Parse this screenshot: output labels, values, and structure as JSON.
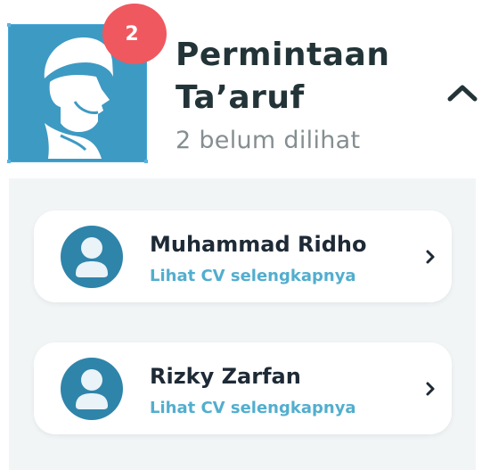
{
  "header": {
    "title_line1": "Permintaan",
    "title_line2": "Ta’aruf",
    "subtitle": "2 belum dilihat",
    "badge_count": "2",
    "logo_icon": "bearded-man-profile-icon",
    "collapse_icon": "chevron-up-icon"
  },
  "requests": [
    {
      "name": "Muhammad Ridho",
      "link": "Lihat CV selengkapnya",
      "avatar_icon": "user-avatar-icon"
    },
    {
      "name": "Rizky Zarfan",
      "link": "Lihat CV selengkapnya",
      "avatar_icon": "user-avatar-icon"
    }
  ],
  "colors": {
    "logo_bg": "#3d9ac3",
    "badge_bg": "#f0585f",
    "title": "#233438",
    "subtitle": "#858e91",
    "panel_bg": "#f1f5f6",
    "link": "#52aecf",
    "avatar": "#2f84aa"
  }
}
